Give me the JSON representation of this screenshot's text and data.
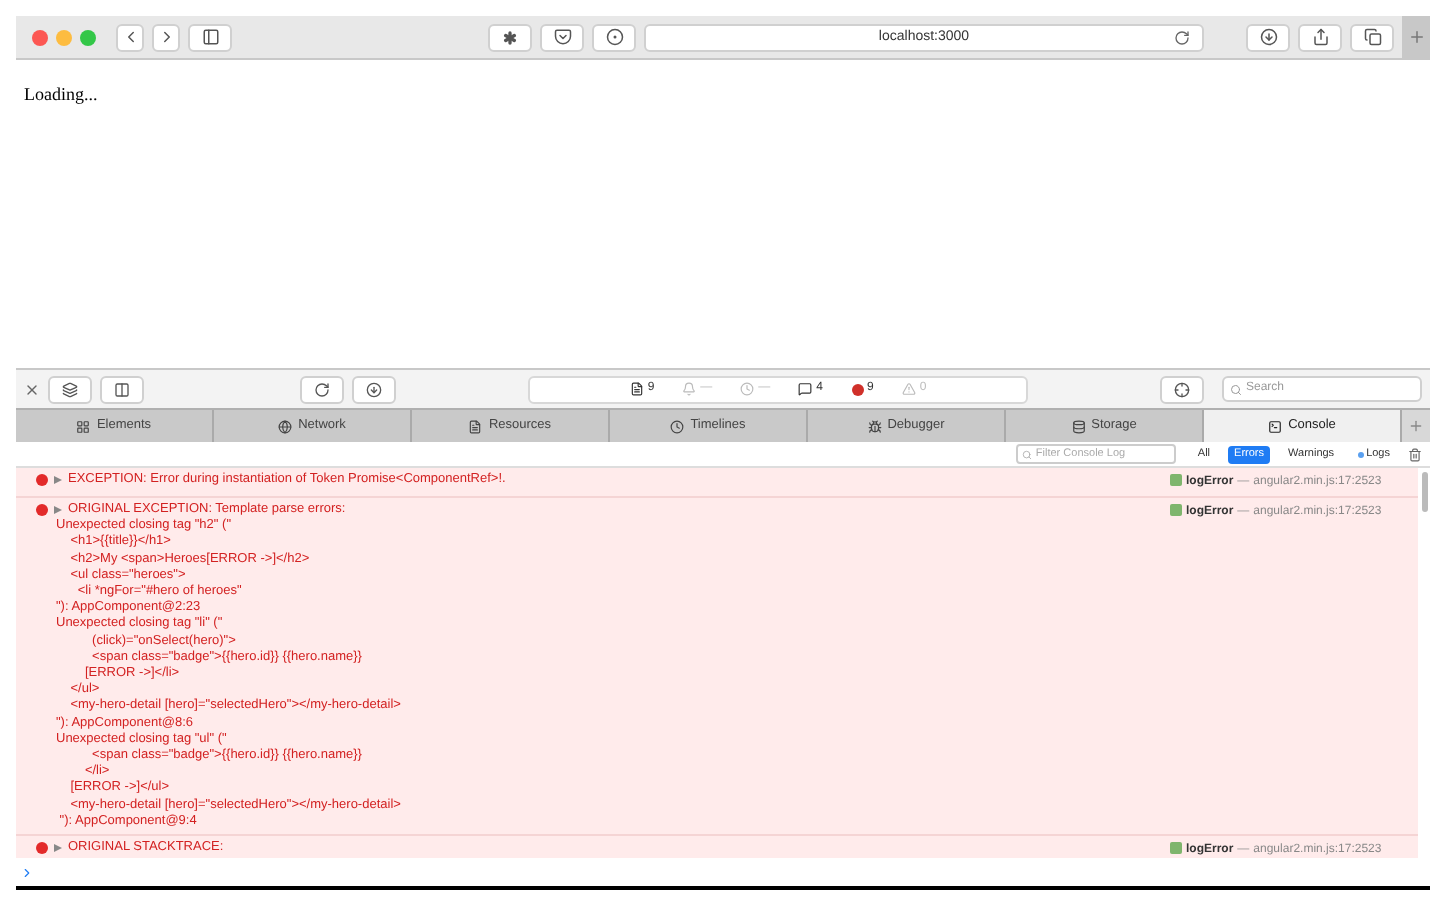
{
  "browser": {
    "url": "localhost:3000"
  },
  "page": {
    "text": "Loading..."
  },
  "devtools": {
    "counts": [
      {
        "kind": "resources",
        "text": "9"
      },
      {
        "kind": "time",
        "text": "—"
      },
      {
        "kind": "clock",
        "text": "—"
      },
      {
        "kind": "logs",
        "text": "4"
      },
      {
        "kind": "errors",
        "text": "9"
      },
      {
        "kind": "warnings",
        "text": "0"
      }
    ],
    "search": {
      "placeholder": "Search"
    },
    "tabs": [
      {
        "label": "Elements",
        "kind": "elements",
        "selected": false
      },
      {
        "label": "Network",
        "kind": "network",
        "selected": false
      },
      {
        "label": "Resources",
        "kind": "resources",
        "selected": false
      },
      {
        "label": "Timelines",
        "kind": "timelines",
        "selected": false
      },
      {
        "label": "Debugger",
        "kind": "debugger",
        "selected": false
      },
      {
        "label": "Storage",
        "kind": "storage",
        "selected": false
      },
      {
        "label": "Console",
        "kind": "console",
        "selected": true
      }
    ],
    "filter": {
      "placeholder": "Filter Console Log"
    },
    "levels": [
      {
        "label": "All",
        "selected": false,
        "dot": false
      },
      {
        "label": "Errors",
        "selected": true,
        "dot": false
      },
      {
        "label": "Warnings",
        "selected": false,
        "dot": false
      },
      {
        "label": "Logs",
        "selected": false,
        "dot": true
      }
    ]
  },
  "messages": [
    {
      "title": "EXCEPTION: Error during instantiation of Token Promise<ComponentRef>!.",
      "function": "logError",
      "location": "angular2.min.js:17:2523",
      "dash": "—"
    },
    {
      "title": "ORIGINAL EXCEPTION: Template parse errors:",
      "function": "logError",
      "location": "angular2.min.js:17:2523",
      "dash": "—",
      "lines": [
        "Unexpected closing tag \"h2\" (\"",
        "    <h1>{{title}}</h1>",
        "    <h2>My <span>Heroes[ERROR ->]</h2>",
        "    <ul class=\"heroes\">",
        "      <li *ngFor=\"#hero of heroes\"",
        "\"): AppComponent@2:23",
        "Unexpected closing tag \"li\" (\"",
        "          (click)=\"onSelect(hero)\">",
        "          <span class=\"badge\">{{hero.id}} {{hero.name}}",
        "        [ERROR ->]</li>",
        "    </ul>",
        "    <my-hero-detail [hero]=\"selectedHero\"></my-hero-detail>",
        "\"): AppComponent@8:6",
        "Unexpected closing tag \"ul\" (\"",
        "          <span class=\"badge\">{{hero.id}} {{hero.name}}",
        "        </li>",
        "    [ERROR ->]</ul>",
        "    <my-hero-detail [hero]=\"selectedHero\"></my-hero-detail>",
        " \"): AppComponent@9:4"
      ]
    },
    {
      "title": "ORIGINAL STACKTRACE:",
      "function": "logError",
      "location": "angular2.min.js:17:2523",
      "dash": "—"
    }
  ]
}
